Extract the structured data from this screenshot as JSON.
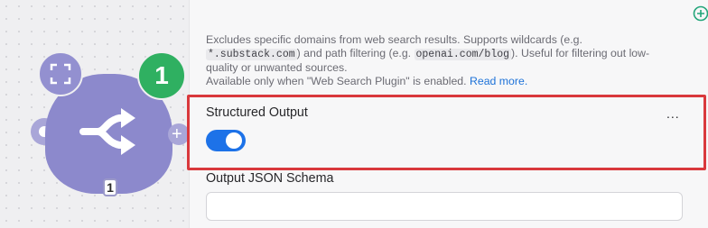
{
  "node": {
    "badge": "1",
    "operations_count": "1",
    "icons": {
      "router": "router-arrows-icon",
      "expand": "expand-corners-icon",
      "side_plus": "plus-icon"
    },
    "side_plus_text": "+"
  },
  "panel": {
    "help_text": {
      "part1": "Excludes specific domains from web search results. Supports wildcards (e.g. ",
      "code1": "*.substack.com",
      "part2": ") and path filtering (e.g. ",
      "code2": "openai.com/blog",
      "part3": "). Useful for filtering out low-quality or unwanted sources.",
      "note": "Available only when \"Web Search Plugin\" is enabled.",
      "link": "Read more."
    },
    "structured_output": {
      "label": "Structured Output",
      "more_label": "...",
      "enabled": true
    },
    "schema_field": {
      "label": "Output JSON Schema",
      "value": ""
    }
  },
  "colors": {
    "node": "#8c89cc",
    "badge": "#2fb061",
    "toggle_on": "#1d72e8",
    "highlight": "#d9383c",
    "link": "#1d72d8"
  }
}
